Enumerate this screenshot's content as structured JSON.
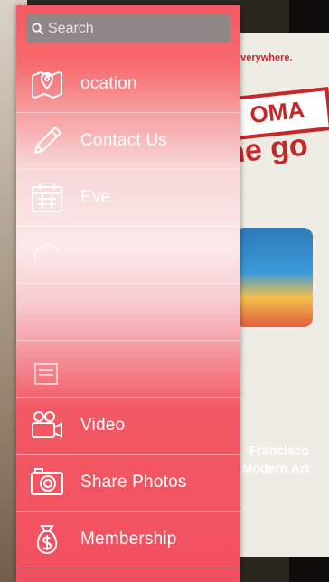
{
  "background": {
    "tagline": "everywhere.",
    "brand_stamp": "OMA",
    "headline": "he go",
    "footer_lines": [
      "Francisco",
      "Modern Art"
    ]
  },
  "search": {
    "placeholder": "Search"
  },
  "menu_items": [
    {
      "label": "ocation",
      "icon": "map-pin-icon"
    },
    {
      "label": "Contact Us",
      "icon": "pencil-icon"
    },
    {
      "label": "Eve",
      "icon": "calendar-icon"
    },
    {
      "label": "",
      "icon": "circle-icon"
    },
    {
      "label": "",
      "icon": ""
    },
    {
      "label": "",
      "icon": "document-icon"
    },
    {
      "label": "Video",
      "icon": "video-camera-icon"
    },
    {
      "label": "Share Photos",
      "icon": "camera-icon"
    },
    {
      "label": "Membership",
      "icon": "money-bag-icon"
    }
  ],
  "colors": {
    "menu_red": "#f45a63",
    "brand_red": "#c62828"
  }
}
